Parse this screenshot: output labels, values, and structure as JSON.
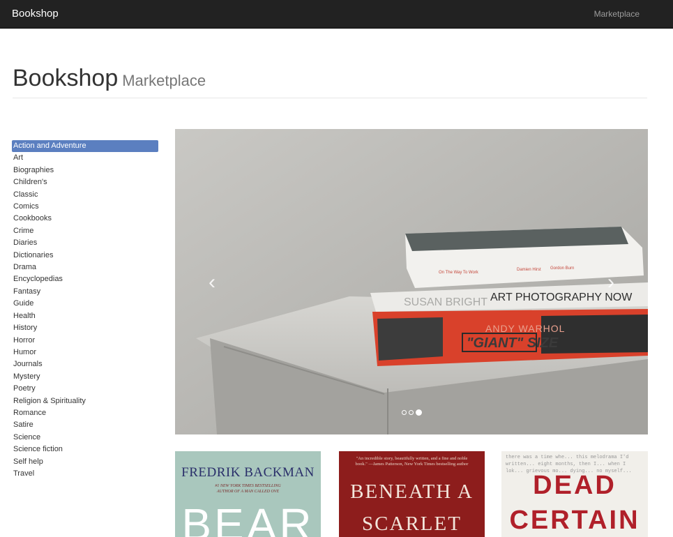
{
  "navbar": {
    "brand": "Bookshop",
    "links": [
      "Marketplace"
    ]
  },
  "header": {
    "title": "Bookshop",
    "subtitle": "Marketplace"
  },
  "categories": {
    "active_index": 0,
    "items": [
      "Action and Adventure",
      "Art",
      "Biographies",
      "Children's",
      "Classic",
      "Comics",
      "Cookbooks",
      "Crime",
      "Diaries",
      "Dictionaries",
      "Drama",
      "Encyclopedias",
      "Fantasy",
      "Guide",
      "Health",
      "History",
      "Horror",
      "Humor",
      "Journals",
      "Mystery",
      "Poetry",
      "Religion & Spirituality",
      "Romance",
      "Satire",
      "Science",
      "Science fiction",
      "Self help",
      "Travel"
    ]
  },
  "carousel": {
    "prev_icon": "chevron-left-icon",
    "next_icon": "chevron-right-icon",
    "slide_count": 3,
    "active_slide": 2,
    "books": {
      "top_authors": [
        "On The Way To Work",
        "Damien Hirst",
        "Gordon Burn"
      ],
      "middle_author": "SUSAN BRIGHT",
      "middle_title": "ART PHOTOGRAPHY NOW",
      "bottom_author": "ANDY WARHOL",
      "bottom_title": "\"GIANT\" SIZE"
    }
  },
  "covers": [
    {
      "author": "FREDRIK BACKMAN",
      "tagline": "#1 NEW YORK TIMES BESTSELLING AUTHOR OF A MAN CALLED OVE",
      "title": "BEAR"
    },
    {
      "quote": "\"An incredible story, beautifully written, and a fine and noble book.\" —James Patterson, New York Times bestselling author",
      "title_line1": "BENEATH A",
      "title_line2": "SCARLET"
    },
    {
      "background_text": "there was a time whe... this melodrama I'd written... eight months, then I... when I lok... grievous mo... dying... no myself...",
      "title_line1": "DEAD",
      "title_line2": "CERTAIN"
    }
  ],
  "colors": {
    "navbar_bg": "#222222",
    "active_category_bg": "#5b7fc0"
  }
}
